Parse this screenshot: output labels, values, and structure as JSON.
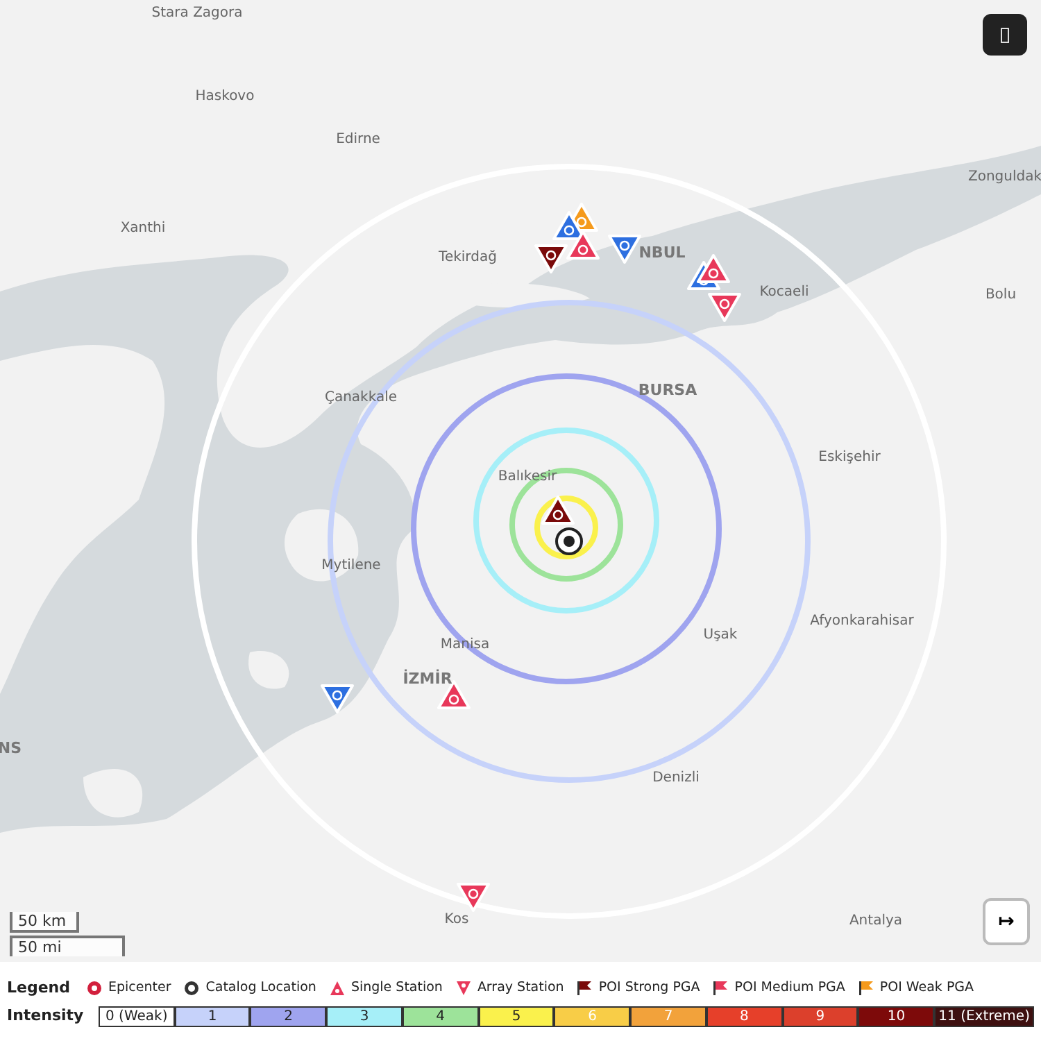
{
  "map": {
    "labels": [
      {
        "text": "Stara Zagora",
        "kind": "city"
      },
      {
        "text": "Haskovo",
        "kind": "city"
      },
      {
        "text": "Edirne",
        "kind": "city"
      },
      {
        "text": "Xanthi",
        "kind": "city"
      },
      {
        "text": "Tekirdağ",
        "kind": "city"
      },
      {
        "text": "NBUL",
        "kind": "major"
      },
      {
        "text": "Zonguldak",
        "kind": "city"
      },
      {
        "text": "Kocaeli",
        "kind": "city"
      },
      {
        "text": "Bolu",
        "kind": "city"
      },
      {
        "text": "Çanakkale",
        "kind": "city"
      },
      {
        "text": "BURSA",
        "kind": "major"
      },
      {
        "text": "Eskişehir",
        "kind": "city"
      },
      {
        "text": "Balıkesir",
        "kind": "city"
      },
      {
        "text": "Mytilene",
        "kind": "city"
      },
      {
        "text": "Manisa",
        "kind": "city"
      },
      {
        "text": "İZMİR",
        "kind": "major"
      },
      {
        "text": "Uşak",
        "kind": "city"
      },
      {
        "text": "Afyonkarahisar",
        "kind": "city"
      },
      {
        "text": "Denizli",
        "kind": "city"
      },
      {
        "text": "Kos",
        "kind": "city"
      },
      {
        "text": "Antalya",
        "kind": "city"
      },
      {
        "text": "NS",
        "kind": "major"
      }
    ],
    "scale": [
      "50 km",
      "50 mi"
    ],
    "collapse_button": {
      "label": "↦"
    }
  },
  "legend": {
    "title": "Legend",
    "items": [
      {
        "label": "Epicenter",
        "kind": "epicenter"
      },
      {
        "label": "Catalog Location",
        "kind": "catalog"
      },
      {
        "label": "Single Station",
        "kind": "single"
      },
      {
        "label": "Array Station",
        "kind": "array"
      },
      {
        "label": "POI Strong PGA",
        "kind": "flag",
        "color": "#7a0a0a"
      },
      {
        "label": "POI Medium PGA",
        "kind": "flag",
        "color": "#e8385a"
      },
      {
        "label": "POI Weak PGA",
        "kind": "flag",
        "color": "#f59a1c"
      }
    ]
  },
  "intensity": {
    "title": "Intensity",
    "levels": [
      {
        "label": "0 (Weak)",
        "color": "#ffffff"
      },
      {
        "label": "1",
        "color": "#c6d2fa"
      },
      {
        "label": "2",
        "color": "#9fa4ef"
      },
      {
        "label": "3",
        "color": "#a6eff8"
      },
      {
        "label": "4",
        "color": "#9de39a"
      },
      {
        "label": "5",
        "color": "#faf14c"
      },
      {
        "label": "6",
        "color": "#f8cd47"
      },
      {
        "label": "7",
        "color": "#f2a23b"
      },
      {
        "label": "8",
        "color": "#e6402a"
      },
      {
        "label": "9",
        "color": "#dc402c"
      },
      {
        "label": "10",
        "color": "#7d0a0a"
      },
      {
        "label": "11 (Extreme)",
        "color": "#3e1010"
      }
    ]
  }
}
